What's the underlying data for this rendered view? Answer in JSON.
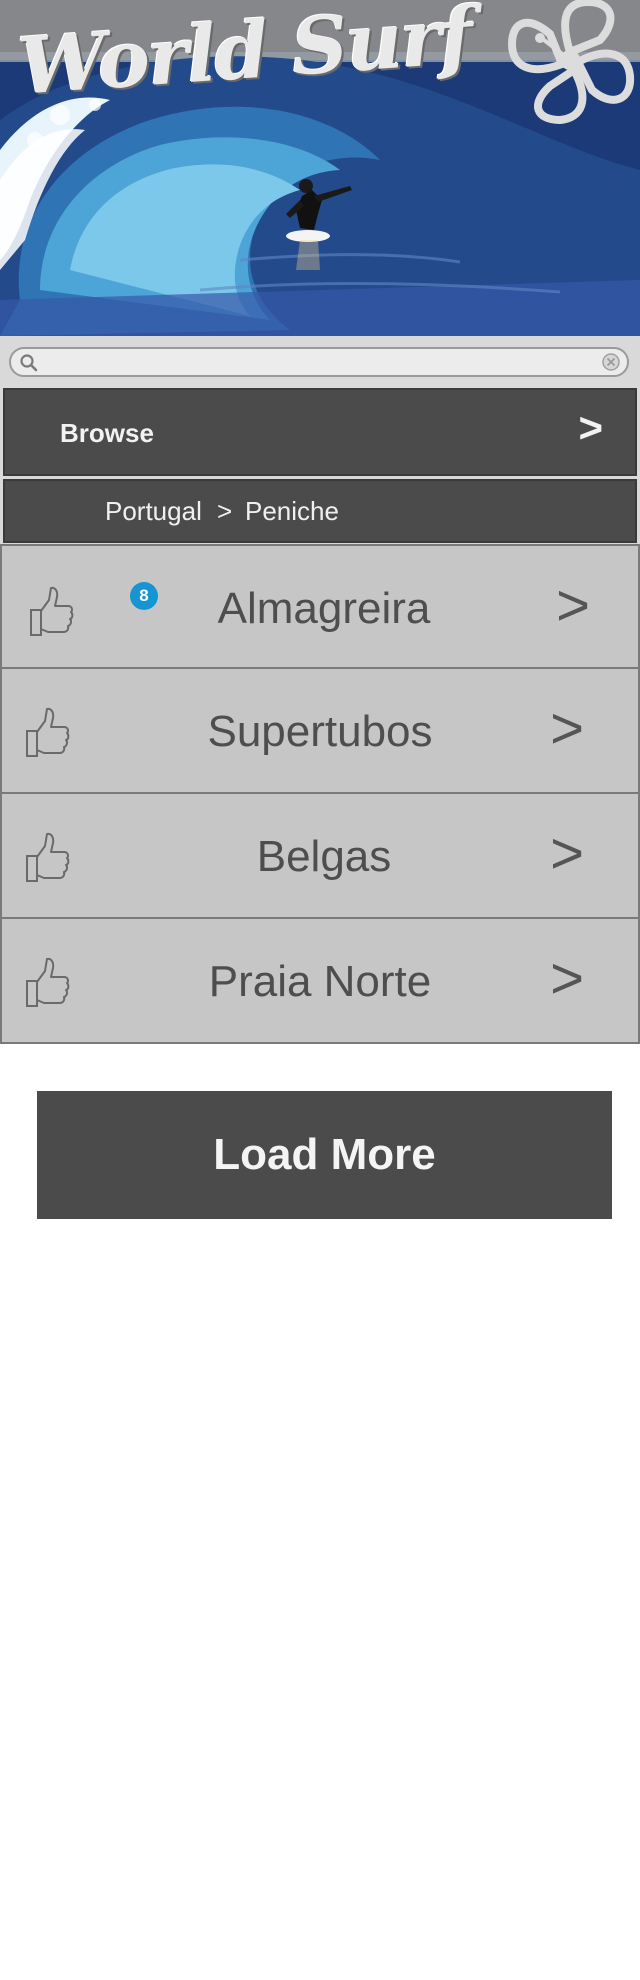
{
  "header": {
    "logo_text": "World Surf"
  },
  "search": {
    "value": "",
    "placeholder": ""
  },
  "browse": {
    "label": "Browse",
    "chevron": ">"
  },
  "breadcrumb": {
    "country": "Portugal",
    "separator": ">",
    "region": "Peniche"
  },
  "spots": [
    {
      "name": "Almagreira",
      "chevron": ">",
      "badge": "8"
    },
    {
      "name": "Supertubos",
      "chevron": ">"
    },
    {
      "name": "Belgas",
      "chevron": ">"
    },
    {
      "name": "Praia Norte",
      "chevron": ">"
    }
  ],
  "load_more_label": "Load More",
  "colors": {
    "bar_dark": "#4b4b4b",
    "row_bg": "#c6c6c6",
    "badge": "#1595d1"
  },
  "icons": [
    "search-icon",
    "clear-icon",
    "thumbs-up-icon",
    "chevron-right-icon",
    "hibiscus-flower-icon"
  ]
}
